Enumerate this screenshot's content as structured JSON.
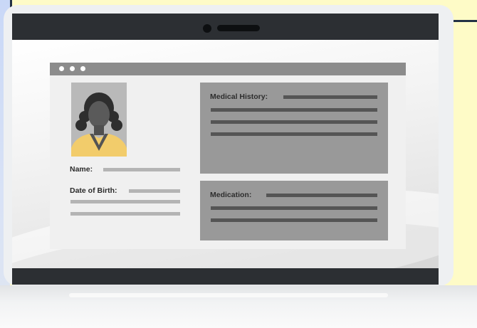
{
  "profile": {
    "name_label": "Name:",
    "dob_label": "Date of Birth:"
  },
  "medical_history": {
    "title": "Medical History:"
  },
  "medication": {
    "title": "Medication:"
  },
  "colors": {
    "background": "#fefbc7",
    "bezel": "#2c2f33",
    "card": "#999999",
    "skin_tone_accent": "#f2cc6b"
  }
}
